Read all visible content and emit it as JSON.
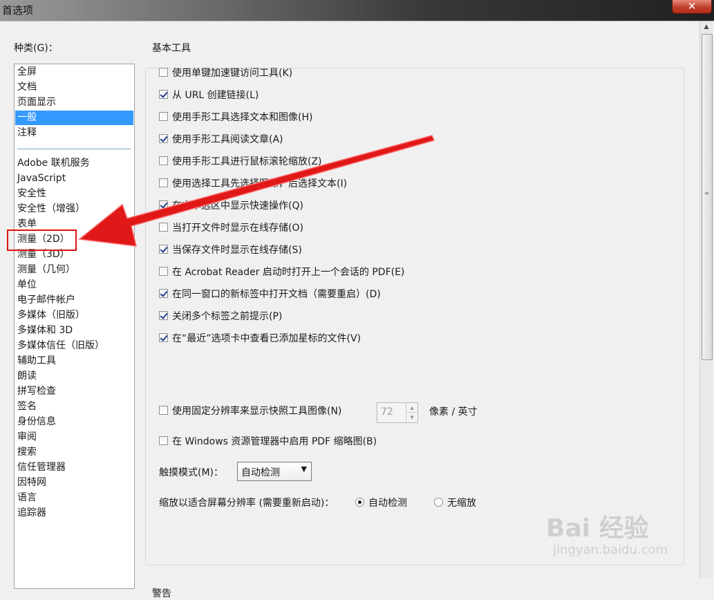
{
  "window": {
    "title": "首选项",
    "close_glyph": "✕"
  },
  "categories": {
    "label": "种类(G)：",
    "items": [
      {
        "label": "全屏"
      },
      {
        "label": "文档"
      },
      {
        "label": "页面显示"
      },
      {
        "label": "一般",
        "selected": true
      },
      {
        "label": "注释"
      },
      {
        "label": "Adobe 联机服务"
      },
      {
        "label": "JavaScript"
      },
      {
        "label": "安全性"
      },
      {
        "label": "安全性（增强）"
      },
      {
        "label": "表单"
      },
      {
        "label": "测量（2D）",
        "highlighted": true
      },
      {
        "label": "测量（3D）"
      },
      {
        "label": "测量（几何）"
      },
      {
        "label": "单位"
      },
      {
        "label": "电子邮件帐户"
      },
      {
        "label": "多媒体（旧版）"
      },
      {
        "label": "多媒体和 3D"
      },
      {
        "label": "多媒体信任（旧版）"
      },
      {
        "label": "辅助工具"
      },
      {
        "label": "朗读"
      },
      {
        "label": "拼写检查"
      },
      {
        "label": "签名"
      },
      {
        "label": "身份信息"
      },
      {
        "label": "审阅"
      },
      {
        "label": "搜索"
      },
      {
        "label": "信任管理器"
      },
      {
        "label": "因特网"
      },
      {
        "label": "语言"
      },
      {
        "label": "追踪器"
      }
    ]
  },
  "basic_tools": {
    "title": "基本工具",
    "options": [
      {
        "label": "使用单键加速键访问工具(K)",
        "checked": false
      },
      {
        "label": "从 URL 创建链接(L)",
        "checked": true
      },
      {
        "label": "使用手形工具选择文本和图像(H)",
        "checked": false
      },
      {
        "label": "使用手形工具阅读文章(A)",
        "checked": true
      },
      {
        "label": "使用手形工具进行鼠标滚轮缩放(Z)",
        "checked": false
      },
      {
        "label": "使用选择工具先选择图像，后选择文本(I)",
        "checked": false
      },
      {
        "label": "在文本选区中显示快速操作(Q)",
        "checked": true
      },
      {
        "label": "当打开文件时显示在线存储(O)",
        "checked": false
      },
      {
        "label": "当保存文件时显示在线存储(S)",
        "checked": true
      },
      {
        "label": "在 Acrobat Reader 启动时打开上一个会话的 PDF(E)",
        "checked": false
      },
      {
        "label": "在同一窗口的新标签中打开文档（需要重启）(D)",
        "checked": true
      },
      {
        "label": "关闭多个标签之前提示(P)",
        "checked": true
      },
      {
        "label": "在“最近”选项卡中查看已添加星标的文件(V)",
        "checked": true
      }
    ],
    "snapshot": {
      "label": "使用固定分辨率来显示快照工具图像(N)",
      "checked": false,
      "value": "72",
      "unit": "像素 / 英寸"
    },
    "thumbnail": {
      "label": "在 Windows 资源管理器中启用 PDF 缩略图(B)",
      "checked": false
    },
    "touch_mode": {
      "label": "触摸模式(M)：",
      "value": "自动检测"
    },
    "zoom": {
      "label": "缩放以适合屏幕分辨率 (需要重新启动)：",
      "options": [
        {
          "label": "自动检测",
          "selected": true
        },
        {
          "label": "无缩放",
          "selected": false
        }
      ]
    }
  },
  "warnings": {
    "title": "警告"
  },
  "watermark": {
    "text": "Bai  经验",
    "sub": "jingyan.baidu.com"
  },
  "colors": {
    "accent": "#3399ff",
    "highlight": "#e01010"
  }
}
